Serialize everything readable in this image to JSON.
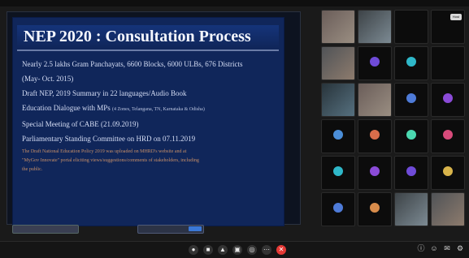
{
  "slide": {
    "title": "NEP 2020 : Consultation Process",
    "lines": [
      {
        "text": "Nearly 2.5 lakhs Gram Panchayats, 6600 Blocks, 6000 ULBs, 676 Districts"
      },
      {
        "text": "(May- Oct. 2015)"
      },
      {
        "text": "Draft NEP, 2019 Summary in 22 languages/Audio Book"
      },
      {
        "text": "Education Dialogue with MPs",
        "small": "(4 Zones, Telangana, TN, Karnataka & Odisha)"
      },
      {
        "text": "Special Meeting of CABE (21.09.2019)"
      },
      {
        "text": "Parliamentary Standing Committee on HRD on 07.11.2019"
      }
    ],
    "orange_lines": [
      "The Draft National Education Policy 2019 was uploaded on MHRD's website and at",
      "\"MyGov Innovate\" portal eliciting views/suggestions/comments of stakeholders, including",
      "the public."
    ]
  },
  "participants": [
    {
      "name": "",
      "style": "video"
    },
    {
      "name": "",
      "style": "video2"
    },
    {
      "name": "",
      "style": "dark"
    },
    {
      "name": "",
      "style": "dark",
      "chip": "Host"
    },
    {
      "name": "",
      "style": "video3"
    },
    {
      "name": "",
      "style": "dark",
      "avatar_color": "#6f4bd8"
    },
    {
      "name": "",
      "style": "dark",
      "avatar_color": "#2fb8c9"
    },
    {
      "name": "",
      "style": "dark"
    },
    {
      "name": "",
      "style": "video4"
    },
    {
      "name": "",
      "style": "video"
    },
    {
      "name": "",
      "style": "dark",
      "avatar_color": "#4e7bd8"
    },
    {
      "name": "",
      "style": "dark",
      "avatar_color": "#8b4bd8"
    },
    {
      "name": "",
      "style": "dark",
      "avatar_color": "#4b8ed8"
    },
    {
      "name": "",
      "style": "dark",
      "avatar_color": "#d86d4b"
    },
    {
      "name": "",
      "style": "dark",
      "avatar_color": "#4bd8b0"
    },
    {
      "name": "",
      "style": "dark",
      "avatar_color": "#d84b7b"
    },
    {
      "name": "",
      "style": "dark",
      "avatar_color": "#2fb8c9"
    },
    {
      "name": "",
      "style": "dark",
      "avatar_color": "#8b4bd8"
    },
    {
      "name": "",
      "style": "dark",
      "avatar_color": "#6f4bd8"
    },
    {
      "name": "",
      "style": "dark",
      "avatar_color": "#d8b44b"
    },
    {
      "name": "",
      "style": "dark",
      "avatar_color": "#4e7bd8"
    },
    {
      "name": "",
      "style": "dark",
      "avatar_color": "#d88c4b"
    },
    {
      "name": "",
      "style": "video2"
    },
    {
      "name": "",
      "style": "video3"
    }
  ],
  "bottom": {
    "title": "",
    "controls": [
      "mic-icon",
      "video-icon",
      "share-icon",
      "chat-icon",
      "participants-icon",
      "more-icon",
      "end-call-icon"
    ],
    "right_icons": [
      "info-icon",
      "people-icon",
      "chat-icon",
      "activities-icon"
    ]
  }
}
